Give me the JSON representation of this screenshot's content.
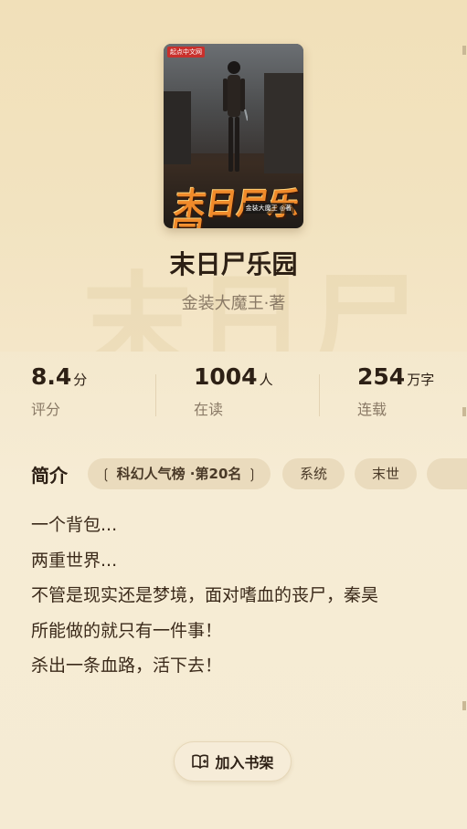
{
  "book": {
    "title": "末日尸乐园",
    "author_line": "金装大魔王·著",
    "cover": {
      "brand": "起点中文网",
      "title_art": "末日尸乐园",
      "author_art": "金装大魔王 ◎著"
    }
  },
  "stats": [
    {
      "value": "8.4",
      "unit": "分",
      "label": "评分"
    },
    {
      "value": "1004",
      "unit": "人",
      "label": "在读"
    },
    {
      "value": "254",
      "unit": "万字",
      "label": "连载"
    }
  ],
  "intro": {
    "label": "简介",
    "tags": [
      {
        "text": "❲ 科幻人气榜 ·第20名 ❳",
        "kind": "rank"
      },
      {
        "text": "系统",
        "kind": "tag"
      },
      {
        "text": "末世",
        "kind": "tag"
      }
    ],
    "lines": [
      "一个背包...",
      "两重世界...",
      "不管是现实还是梦境，面对嗜血的丧尸，秦昊",
      "所能做的就只有一件事！",
      "杀出一条血路，活下去！"
    ]
  },
  "actions": {
    "add_to_shelf": "加入书架"
  },
  "colors": {
    "background": "#f3e6c6",
    "text_primary": "#2d2015",
    "text_secondary": "#8a7a66",
    "tag_bg": "#eadbbd"
  },
  "icons": {
    "add_to_shelf": "book-add-icon"
  }
}
